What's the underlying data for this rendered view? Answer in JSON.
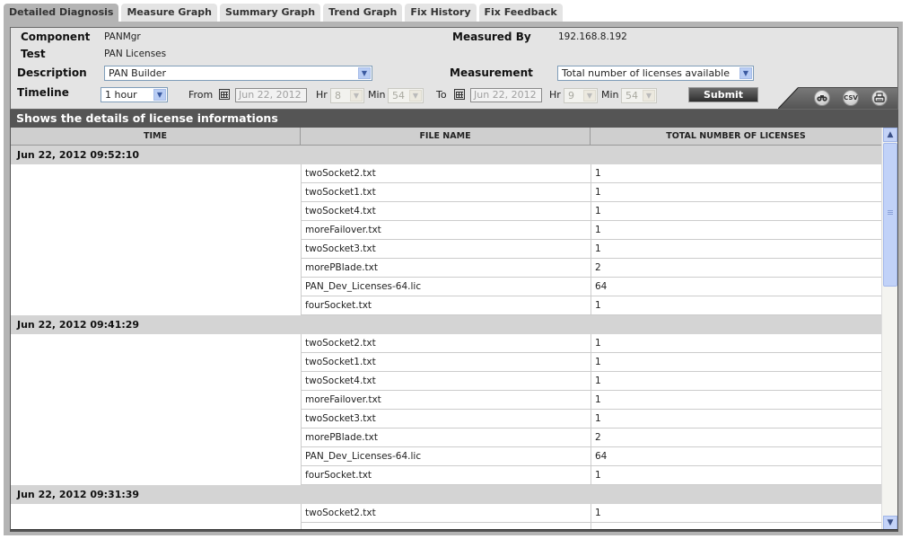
{
  "tabs": [
    {
      "label": "Detailed Diagnosis",
      "active": true
    },
    {
      "label": "Measure Graph",
      "active": false
    },
    {
      "label": "Summary Graph",
      "active": false
    },
    {
      "label": "Trend Graph",
      "active": false
    },
    {
      "label": "Fix History",
      "active": false
    },
    {
      "label": "Fix Feedback",
      "active": false
    }
  ],
  "info": {
    "component_label": "Component",
    "component_value": "PANMgr",
    "test_label": "Test",
    "test_value": "PAN Licenses",
    "description_label": "Description",
    "description_value": "PAN Builder",
    "measured_by_label": "Measured By",
    "measured_by_value": "192.168.8.192",
    "measurement_label": "Measurement",
    "measurement_value": "Total number of licenses available",
    "timeline_label": "Timeline",
    "timeline_value": "1 hour",
    "from_label": "From",
    "from_date": "Jun 22, 2012",
    "from_hr_label": "Hr",
    "from_hr": "8",
    "from_min_label": "Min",
    "from_min": "54",
    "to_label": "To",
    "to_date": "Jun 22, 2012",
    "to_hr_label": "Hr",
    "to_hr": "9",
    "to_min_label": "Min",
    "to_min": "54",
    "submit_label": "Submit",
    "csv_label": "CSV"
  },
  "results": {
    "title": "Shows the details of license informations",
    "columns": [
      "TIME",
      "FILE NAME",
      "TOTAL NUMBER OF LICENSES"
    ],
    "groups": [
      {
        "time": "Jun 22, 2012 09:52:10",
        "rows": [
          {
            "file": "twoSocket2.txt",
            "count": "1"
          },
          {
            "file": "twoSocket1.txt",
            "count": "1"
          },
          {
            "file": "twoSocket4.txt",
            "count": "1"
          },
          {
            "file": "moreFailover.txt",
            "count": "1"
          },
          {
            "file": "twoSocket3.txt",
            "count": "1"
          },
          {
            "file": "morePBlade.txt",
            "count": "2"
          },
          {
            "file": "PAN_Dev_Licenses-64.lic",
            "count": "64"
          },
          {
            "file": "fourSocket.txt",
            "count": "1"
          }
        ]
      },
      {
        "time": "Jun 22, 2012 09:41:29",
        "rows": [
          {
            "file": "twoSocket2.txt",
            "count": "1"
          },
          {
            "file": "twoSocket1.txt",
            "count": "1"
          },
          {
            "file": "twoSocket4.txt",
            "count": "1"
          },
          {
            "file": "moreFailover.txt",
            "count": "1"
          },
          {
            "file": "twoSocket3.txt",
            "count": "1"
          },
          {
            "file": "morePBlade.txt",
            "count": "2"
          },
          {
            "file": "PAN_Dev_Licenses-64.lic",
            "count": "64"
          },
          {
            "file": "fourSocket.txt",
            "count": "1"
          }
        ]
      },
      {
        "time": "Jun 22, 2012 09:31:39",
        "rows": [
          {
            "file": "twoSocket2.txt",
            "count": "1"
          },
          {
            "file": "",
            "count": ""
          }
        ]
      }
    ]
  }
}
